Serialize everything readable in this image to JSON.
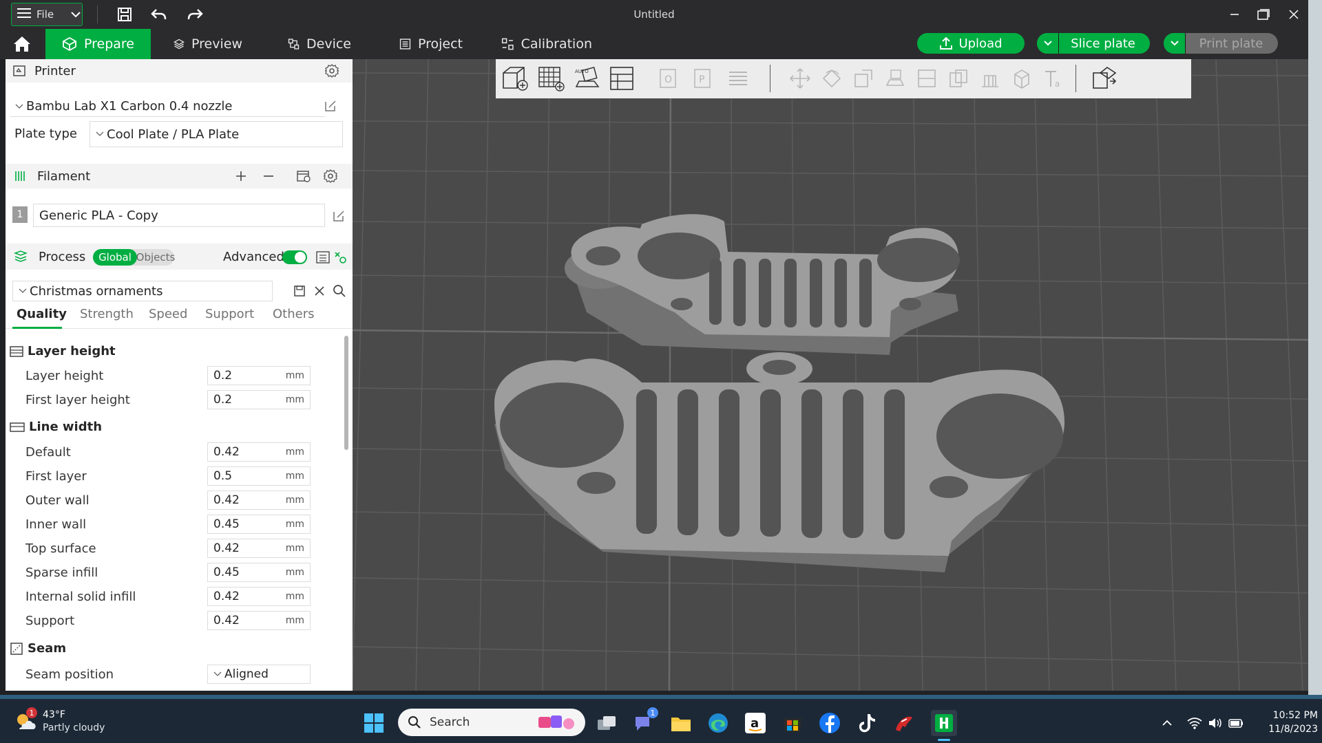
{
  "window": {
    "title": "Untitled",
    "file_label": "File"
  },
  "nav": {
    "tabs": [
      {
        "label": "Prepare",
        "active": true
      },
      {
        "label": "Preview"
      },
      {
        "label": "Device"
      },
      {
        "label": "Project"
      },
      {
        "label": "Calibration"
      }
    ],
    "upload_label": "Upload",
    "slice_label": "Slice plate",
    "print_label": "Print plate"
  },
  "printer": {
    "section_label": "Printer",
    "preset": "Bambu Lab X1 Carbon 0.4 nozzle",
    "plate_type_label": "Plate type",
    "plate_type_value": "Cool Plate / PLA Plate"
  },
  "filament": {
    "section_label": "Filament",
    "slot_number": "1",
    "preset": "Generic PLA - Copy"
  },
  "process": {
    "section_label": "Process",
    "global_label": "Global",
    "objects_label": "Objects",
    "advanced_label": "Advanced",
    "preset": "Christmas ornaments",
    "tabs": [
      "Quality",
      "Strength",
      "Speed",
      "Support",
      "Others"
    ],
    "groups": {
      "layer_height": {
        "title": "Layer height",
        "rows": [
          {
            "label": "Layer height",
            "value": "0.2",
            "unit": "mm"
          },
          {
            "label": "First layer height",
            "value": "0.2",
            "unit": "mm"
          }
        ]
      },
      "line_width": {
        "title": "Line width",
        "rows": [
          {
            "label": "Default",
            "value": "0.42",
            "unit": "mm"
          },
          {
            "label": "First layer",
            "value": "0.5",
            "unit": "mm"
          },
          {
            "label": "Outer wall",
            "value": "0.42",
            "unit": "mm"
          },
          {
            "label": "Inner wall",
            "value": "0.45",
            "unit": "mm"
          },
          {
            "label": "Top surface",
            "value": "0.42",
            "unit": "mm"
          },
          {
            "label": "Sparse infill",
            "value": "0.45",
            "unit": "mm"
          },
          {
            "label": "Internal solid infill",
            "value": "0.42",
            "unit": "mm"
          },
          {
            "label": "Support",
            "value": "0.42",
            "unit": "mm"
          }
        ]
      },
      "seam": {
        "title": "Seam",
        "rows": [
          {
            "label": "Seam position",
            "value": "Aligned"
          }
        ]
      }
    }
  },
  "taskbar": {
    "weather_temp": "43°F",
    "weather_desc": "Partly cloudy",
    "weather_badge": "1",
    "search_placeholder": "Search",
    "teams_badge": "1",
    "time": "10:52 PM",
    "date": "11/8/2023"
  },
  "colors": {
    "accent": "#00ae42",
    "chrome": "#2b2b2d",
    "viewport": "#4a4a4b",
    "model": "#9a9a9a"
  }
}
